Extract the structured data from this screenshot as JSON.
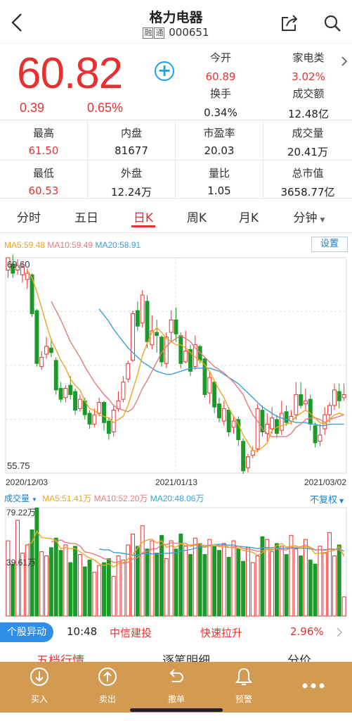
{
  "header": {
    "title": "格力电器",
    "tag1": "融",
    "tag2": "通",
    "code": "000651"
  },
  "quote": {
    "price": "60.82",
    "change": "0.39",
    "change_pct": "0.65%",
    "cells": [
      {
        "label": "今开",
        "value": "60.89",
        "red": true
      },
      {
        "label": "家电类",
        "value": "3.02%",
        "red": true
      },
      {
        "label": "换手",
        "value": "0.34%",
        "red": false
      },
      {
        "label": "成交额",
        "value": "12.48亿",
        "red": false
      }
    ]
  },
  "stats": {
    "row1": [
      {
        "label": "最高",
        "value": "61.50",
        "red": true
      },
      {
        "label": "内盘",
        "value": "81677",
        "red": false
      },
      {
        "label": "市盈率",
        "value": "20.03",
        "red": false
      },
      {
        "label": "成交量",
        "value": "20.41万",
        "red": false
      }
    ],
    "row2": [
      {
        "label": "最低",
        "value": "60.53",
        "red": true
      },
      {
        "label": "外盘",
        "value": "12.24万",
        "red": false
      },
      {
        "label": "量比",
        "value": "1.05",
        "red": false
      },
      {
        "label": "总市值",
        "value": "3658.77亿",
        "red": false
      }
    ]
  },
  "tabs": [
    "分时",
    "五日",
    "日K",
    "周K",
    "月K",
    "分钟"
  ],
  "active_tab": "日K",
  "ma": {
    "ma5": "MA5:59.48",
    "ma10": "MA10:59.49",
    "ma20": "MA20:58.91",
    "setting": "设置"
  },
  "chart_data": {
    "type": "candlestick",
    "y_max_label": "69.60",
    "y_min_label": "55.75",
    "ylim": [
      55.75,
      69.6
    ],
    "x_labels": [
      "2020/12/03",
      "2021/01/13",
      "2021/03/02"
    ],
    "candles": [
      [
        68.8,
        69.6,
        69.6,
        68.3
      ],
      [
        69.2,
        68.6,
        69.8,
        68.3
      ],
      [
        68.8,
        69.1,
        69.5,
        68.5
      ],
      [
        68.5,
        69.0,
        69.3,
        68.0
      ],
      [
        68.2,
        68.6,
        68.9,
        67.6
      ],
      [
        68.5,
        66.0,
        68.6,
        65.8
      ],
      [
        66.2,
        62.8,
        66.3,
        62.6
      ],
      [
        62.6,
        63.2,
        63.6,
        62.4
      ],
      [
        63.4,
        63.9,
        64.5,
        63.1
      ],
      [
        63.8,
        63.5,
        64.4,
        63.2
      ],
      [
        63.0,
        61.1,
        63.2,
        60.8
      ],
      [
        61.2,
        60.5,
        61.6,
        60.3
      ],
      [
        60.6,
        61.2,
        61.4,
        60.3
      ],
      [
        61.4,
        60.8,
        62.0,
        60.5
      ],
      [
        61.0,
        59.8,
        61.2,
        59.5
      ],
      [
        59.9,
        60.5,
        60.8,
        59.7
      ],
      [
        60.4,
        59.5,
        60.6,
        59.2
      ],
      [
        59.6,
        58.9,
        59.8,
        58.6
      ],
      [
        58.9,
        59.5,
        59.9,
        58.7
      ],
      [
        59.6,
        60.3,
        60.6,
        59.4
      ],
      [
        60.3,
        59.0,
        60.4,
        58.5
      ],
      [
        59.1,
        58.3,
        59.3,
        57.9
      ],
      [
        58.4,
        59.8,
        60.1,
        58.1
      ],
      [
        59.9,
        60.4,
        61.0,
        59.7
      ],
      [
        60.5,
        61.6,
        62.0,
        60.3
      ],
      [
        61.8,
        62.8,
        63.0,
        61.6
      ],
      [
        63.0,
        66.0,
        66.2,
        62.9
      ],
      [
        66.2,
        65.2,
        66.8,
        64.9
      ],
      [
        65.4,
        67.2,
        67.5,
        65.1
      ],
      [
        66.8,
        64.2,
        67.2,
        63.8
      ],
      [
        64.0,
        64.9,
        65.9,
        63.7
      ],
      [
        64.8,
        64.6,
        65.6,
        63.5
      ],
      [
        64.5,
        62.9,
        64.6,
        62.6
      ],
      [
        62.8,
        64.5,
        64.8,
        62.5
      ],
      [
        64.8,
        65.6,
        66.2,
        64.2
      ],
      [
        65.6,
        64.7,
        66.4,
        64.2
      ],
      [
        64.6,
        62.8,
        64.8,
        62.5
      ],
      [
        62.9,
        63.6,
        64.9,
        62.8
      ],
      [
        63.7,
        62.3,
        64.0,
        62.0
      ],
      [
        62.6,
        64.0,
        64.6,
        62.4
      ],
      [
        63.9,
        63.0,
        64.0,
        62.8
      ],
      [
        63.1,
        60.8,
        63.2,
        60.6
      ],
      [
        60.9,
        61.9,
        62.3,
        60.2
      ],
      [
        61.6,
        60.0,
        61.7,
        59.6
      ],
      [
        60.2,
        59.3,
        60.6,
        59.0
      ],
      [
        59.1,
        59.9,
        60.4,
        58.8
      ],
      [
        59.8,
        58.4,
        60.0,
        58.1
      ],
      [
        58.7,
        59.1,
        59.4,
        58.3
      ],
      [
        59.2,
        57.9,
        59.4,
        57.5
      ],
      [
        57.8,
        55.9,
        58.0,
        55.7
      ],
      [
        56.1,
        56.8,
        57.0,
        55.8
      ],
      [
        56.9,
        57.2,
        57.5,
        56.7
      ],
      [
        57.3,
        59.9,
        60.2,
        57.1
      ],
      [
        59.8,
        58.4,
        60.1,
        58.1
      ],
      [
        58.3,
        58.9,
        59.6,
        57.8
      ],
      [
        58.6,
        59.3,
        60.0,
        58.3
      ],
      [
        59.2,
        58.3,
        59.5,
        58.0
      ],
      [
        58.5,
        59.6,
        60.4,
        58.2
      ],
      [
        59.7,
        59.0,
        60.1,
        58.8
      ],
      [
        59.1,
        59.4,
        59.8,
        58.9
      ],
      [
        59.5,
        60.8,
        61.6,
        59.2
      ],
      [
        60.8,
        60.1,
        61.6,
        59.9
      ],
      [
        60.2,
        60.4,
        61.2,
        59.8
      ],
      [
        60.5,
        58.9,
        60.8,
        58.5
      ],
      [
        58.8,
        57.7,
        59.0,
        57.4
      ],
      [
        57.8,
        58.2,
        58.9,
        57.5
      ],
      [
        58.6,
        59.5,
        60.0,
        58.2
      ],
      [
        59.5,
        60.1,
        60.3,
        59.0
      ],
      [
        60.1,
        61.1,
        61.5,
        59.8
      ],
      [
        61.0,
        60.4,
        61.5,
        59.9
      ],
      [
        60.6,
        60.8,
        61.5,
        60.4
      ]
    ],
    "ma5": [
      null,
      null,
      null,
      null,
      68.8,
      68.3,
      67.4,
      66.4,
      65.3,
      64.3,
      63.7,
      63.0,
      62.5,
      61.8,
      61.4,
      61.1,
      60.4,
      59.9,
      59.8,
      59.5,
      59.4,
      59.3,
      59.0,
      59.2,
      59.4,
      60.1,
      61.1,
      62.1,
      63.3,
      64.1,
      64.8,
      65.1,
      64.8,
      64.4,
      64.2,
      64.0,
      64.0,
      63.8,
      63.5,
      63.2,
      63.0,
      62.7,
      62.3,
      61.7,
      61.1,
      60.6,
      59.9,
      59.4,
      58.9,
      58.2,
      57.7,
      57.2,
      57.2,
      57.4,
      57.7,
      58.5,
      58.7,
      58.8,
      58.9,
      59.0,
      59.4,
      59.6,
      59.8,
      59.6,
      59.3,
      59.0,
      58.9,
      59.2,
      59.5,
      59.6,
      59.5
    ],
    "ma10": [
      null,
      null,
      null,
      null,
      null,
      null,
      null,
      null,
      null,
      66.8,
      66.2,
      65.6,
      64.9,
      64.2,
      63.7,
      63.2,
      62.6,
      62.1,
      61.6,
      61.2,
      60.8,
      60.5,
      60.1,
      59.9,
      59.8,
      59.7,
      59.9,
      60.5,
      61.2,
      61.7,
      62.3,
      62.9,
      63.5,
      63.9,
      64.2,
      64.4,
      64.6,
      64.4,
      64.2,
      63.8,
      63.5,
      63.2,
      62.9,
      62.6,
      62.4,
      62.2,
      61.9,
      61.6,
      61.2,
      60.8,
      60.1,
      59.5,
      59.1,
      58.6,
      58.3,
      58.1,
      58.1,
      58.1,
      58.1,
      58.3,
      58.7,
      58.9,
      59.2,
      59.3,
      59.3,
      59.2,
      59.0,
      59.2,
      59.3,
      59.4,
      59.5
    ],
    "ma20": [
      null,
      null,
      null,
      null,
      null,
      null,
      null,
      null,
      null,
      null,
      null,
      null,
      null,
      null,
      null,
      null,
      null,
      null,
      null,
      66.3,
      65.9,
      65.5,
      65.0,
      64.6,
      64.2,
      63.8,
      63.5,
      63.2,
      62.9,
      62.7,
      62.5,
      62.3,
      62.2,
      62.1,
      62.1,
      62.2,
      62.3,
      62.4,
      62.5,
      62.5,
      62.5,
      62.5,
      62.5,
      62.4,
      62.3,
      62.1,
      61.9,
      61.7,
      61.5,
      61.2,
      60.9,
      60.6,
      60.3,
      60.0,
      59.8,
      59.6,
      59.4,
      59.3,
      59.2,
      59.1,
      59.0,
      59.0,
      59.0,
      58.9,
      58.9,
      58.8,
      58.8,
      58.9,
      58.9,
      58.9,
      58.9
    ]
  },
  "volume": {
    "label": "成交量",
    "ma5": "MA5:51.41万",
    "ma10": "MA10:52.20万",
    "ma20": "MA20:48.06万",
    "fuquan": "不复权",
    "max_label": "79.22万",
    "mid_label": "39.61万",
    "max": 79.22,
    "values": [
      55,
      38,
      70,
      46,
      52,
      63,
      79,
      47,
      44,
      50,
      57,
      48,
      52,
      39,
      51,
      45,
      36,
      41,
      32,
      37,
      39,
      42,
      29,
      44,
      41,
      52,
      60,
      51,
      66,
      49,
      55,
      46,
      59,
      42,
      55,
      49,
      60,
      51,
      45,
      57,
      53,
      45,
      56,
      51,
      48,
      53,
      43,
      55,
      49,
      40,
      50,
      39,
      44,
      58,
      56,
      47,
      53,
      51,
      45,
      59,
      49,
      44,
      56,
      41,
      38,
      51,
      46,
      61,
      44,
      52,
      14
    ]
  },
  "alert": {
    "badge": "个股异动",
    "time": "10:48",
    "broker": "中信建投",
    "event": "快速拉升",
    "pct": "2.96%"
  },
  "subtabs": [
    "五档行情",
    "逐笔明细",
    "分价"
  ],
  "bottom_bar": [
    {
      "label": "买入",
      "icon": "buy-icon"
    },
    {
      "label": "卖出",
      "icon": "sell-icon"
    },
    {
      "label": "撤单",
      "icon": "undo-icon"
    },
    {
      "label": "预警",
      "icon": "bell-icon"
    },
    {
      "label": "",
      "icon": "more-icon"
    }
  ]
}
